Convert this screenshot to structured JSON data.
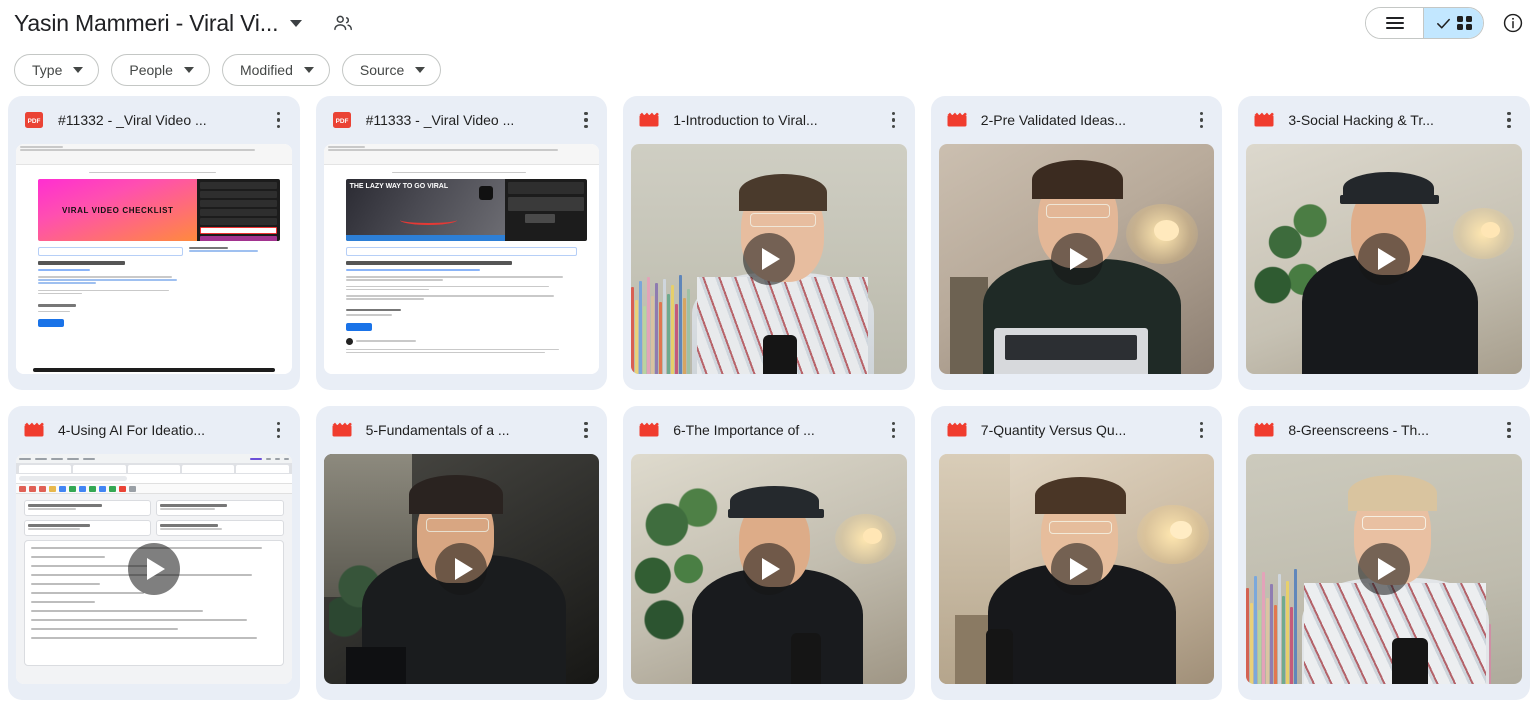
{
  "header": {
    "doc_title": "Yasin Mammeri - Viral Vi...",
    "title_caret_icon": "chevron-down-icon",
    "people_icon": "people-icon",
    "view_toggle": {
      "list_icon": "list-view-icon",
      "grid_icon": "grid-view-icon",
      "check_icon": "check-icon",
      "active": "grid",
      "active_bg": "#c2e7ff"
    },
    "info_icon": "info-icon"
  },
  "filters": [
    {
      "label": "Type",
      "caret_icon": "chevron-down-icon"
    },
    {
      "label": "People",
      "caret_icon": "chevron-down-icon"
    },
    {
      "label": "Modified",
      "caret_icon": "chevron-down-icon"
    },
    {
      "label": "Source",
      "caret_icon": "chevron-down-icon"
    }
  ],
  "colors": {
    "card_bg": "#e9eef6",
    "pdf_red": "#ea4335",
    "video_red": "#f03c2e",
    "accent_blue": "#c2e7ff",
    "text": "#1f1f1f"
  },
  "files": [
    {
      "title": "#11332 - _Viral Video ...",
      "file_type": "pdf",
      "icon": "pdf-file-icon",
      "icon_label": "PDF",
      "thumb_kind": "pdf-checklist",
      "thumb_banner_text": "VIRAL VIDEO CHECKLIST",
      "thumb_heading": "Viral Video Checklist",
      "has_play": false
    },
    {
      "title": "#11333 - _Viral Video ...",
      "file_type": "pdf",
      "icon": "pdf-file-icon",
      "icon_label": "PDF",
      "thumb_kind": "pdf-lazy",
      "thumb_banner_text": "THE LAZY WAY TO GO VIRAL",
      "thumb_heading": "What is the best video length?",
      "has_play": false
    },
    {
      "title": "1-Introduction to Viral...",
      "file_type": "video",
      "icon": "video-file-icon",
      "thumb_kind": "video-bookshelf-smile",
      "has_play": true
    },
    {
      "title": "2-Pre Validated Ideas...",
      "file_type": "video",
      "icon": "video-file-icon",
      "thumb_kind": "video-desk-lamp",
      "has_play": true
    },
    {
      "title": "3-Social Hacking & Tr...",
      "file_type": "video",
      "icon": "video-file-icon",
      "thumb_kind": "video-plant-cap",
      "has_play": true
    },
    {
      "title": "4-Using AI For Ideatio...",
      "file_type": "video",
      "icon": "video-file-icon",
      "thumb_kind": "screen-recording",
      "has_play": true
    },
    {
      "title": "5-Fundamentals of a ...",
      "file_type": "video",
      "icon": "video-file-icon",
      "thumb_kind": "video-dark-room",
      "has_play": true
    },
    {
      "title": "6-The Importance of ...",
      "file_type": "video",
      "icon": "video-file-icon",
      "thumb_kind": "video-plant-cap-2",
      "has_play": true
    },
    {
      "title": "7-Quantity Versus Qu...",
      "file_type": "video",
      "icon": "video-file-icon",
      "thumb_kind": "video-warm-room",
      "has_play": true
    },
    {
      "title": "8-Greenscreens - Th...",
      "file_type": "video",
      "icon": "video-file-icon",
      "thumb_kind": "video-bookshelf-shirt",
      "has_play": true
    }
  ]
}
